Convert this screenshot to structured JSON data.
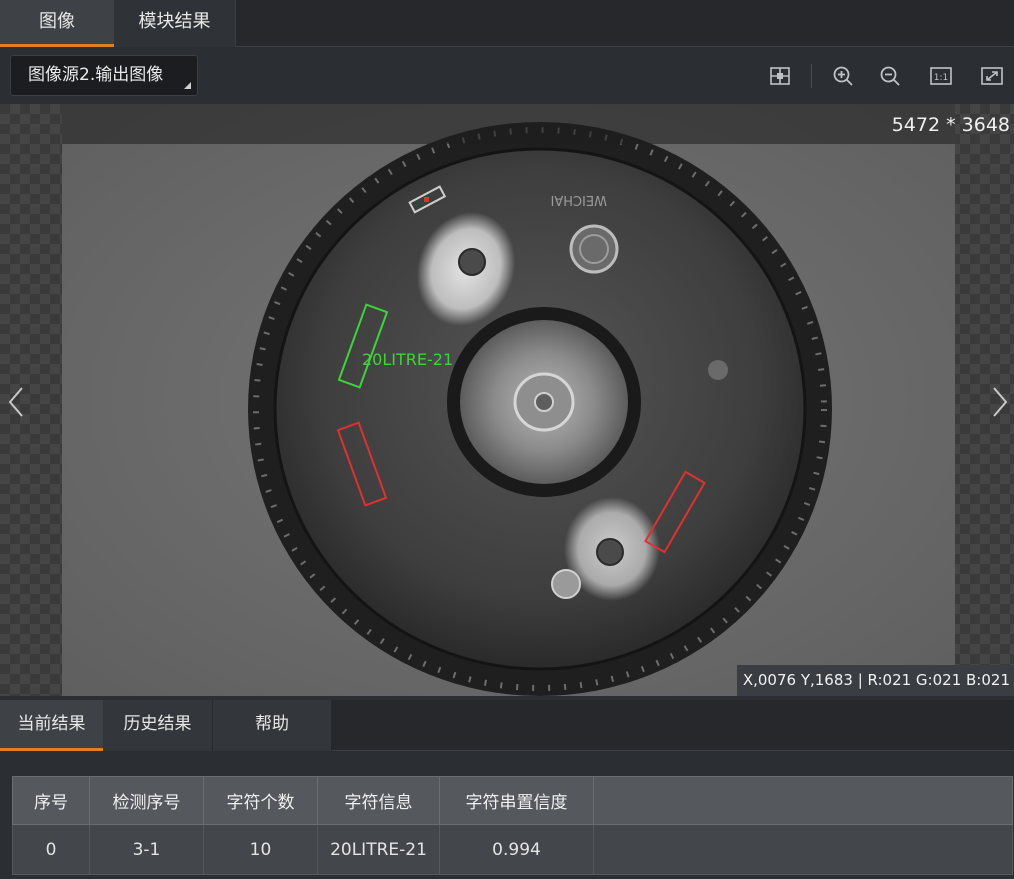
{
  "top_tabs": [
    {
      "label": "图像"
    },
    {
      "label": "模块结果"
    }
  ],
  "toolbar": {
    "image_source": "图像源2.输出图像",
    "icons": [
      "fit-grid-icon",
      "zoom-in-icon",
      "zoom-out-icon",
      "actual-size-icon",
      "fullscreen-icon"
    ]
  },
  "viewer": {
    "resolution": "5472 * 3648",
    "ocr_label": "20LITRE-21",
    "pixel_info": "X,0076  Y,1683  |  R:021  G:021  B:021",
    "colors": {
      "match_box": "#3cd43a",
      "miss_box": "#e03030"
    }
  },
  "result_tabs": [
    {
      "label": "当前结果"
    },
    {
      "label": "历史结果"
    },
    {
      "label": "帮助"
    }
  ],
  "table": {
    "headers": [
      "序号",
      "检测序号",
      "字符个数",
      "字符信息",
      "字符串置信度"
    ],
    "rows": [
      [
        "0",
        "3-1",
        "10",
        "20LITRE-21",
        "0.994"
      ]
    ]
  },
  "colors": {
    "accent": "#d9822b"
  }
}
